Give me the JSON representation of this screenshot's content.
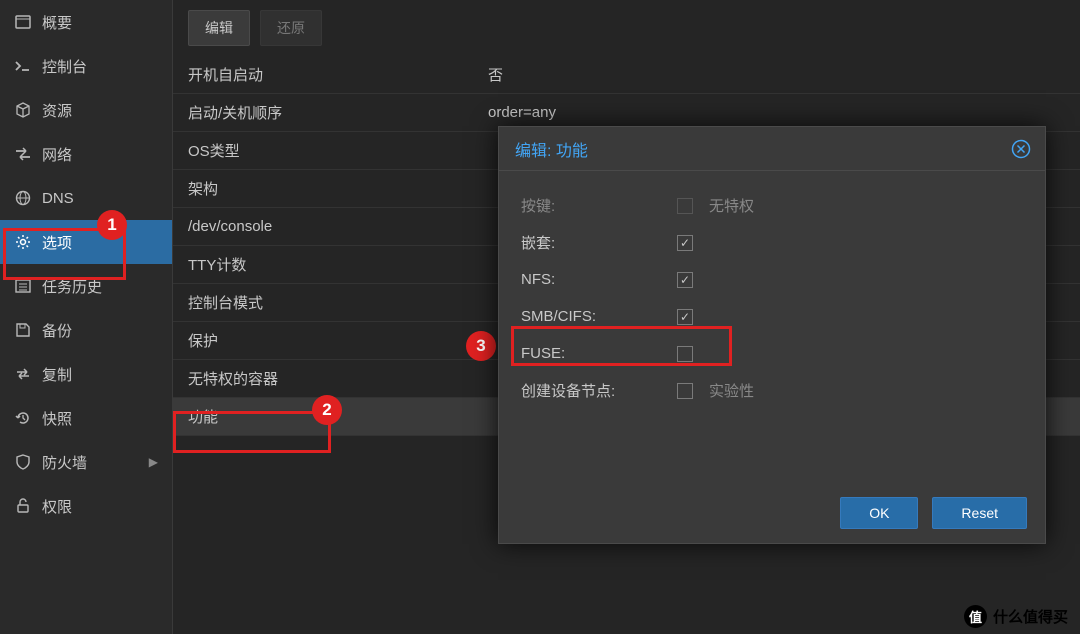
{
  "sidebar": {
    "items": [
      {
        "label": "概要",
        "icon": "summary"
      },
      {
        "label": "控制台",
        "icon": "console"
      },
      {
        "label": "资源",
        "icon": "resources"
      },
      {
        "label": "网络",
        "icon": "network"
      },
      {
        "label": "DNS",
        "icon": "dns"
      },
      {
        "label": "选项",
        "icon": "options",
        "active": true
      },
      {
        "label": "任务历史",
        "icon": "history"
      },
      {
        "label": "备份",
        "icon": "backup"
      },
      {
        "label": "复制",
        "icon": "replicate"
      },
      {
        "label": "快照",
        "icon": "snapshot"
      },
      {
        "label": "防火墙",
        "icon": "firewall",
        "expandable": true
      },
      {
        "label": "权限",
        "icon": "permissions"
      }
    ]
  },
  "toolbar": {
    "edit_label": "编辑",
    "revert_label": "还原"
  },
  "options": [
    {
      "label": "开机自启动",
      "value": "否"
    },
    {
      "label": "启动/关机顺序",
      "value": "order=any"
    },
    {
      "label": "OS类型",
      "value": ""
    },
    {
      "label": "架构",
      "value": ""
    },
    {
      "label": "/dev/console",
      "value": ""
    },
    {
      "label": "TTY计数",
      "value": ""
    },
    {
      "label": "控制台模式",
      "value": ""
    },
    {
      "label": "保护",
      "value": ""
    },
    {
      "label": "无特权的容器",
      "value": ""
    },
    {
      "label": "功能",
      "value": "",
      "selected": true
    }
  ],
  "dialog": {
    "title": "编辑: 功能",
    "rows": [
      {
        "label": "按键:",
        "checked": false,
        "suffix": "无特权",
        "disabled": true
      },
      {
        "label": "嵌套:",
        "checked": true
      },
      {
        "label": "NFS:",
        "checked": true
      },
      {
        "label": "SMB/CIFS:",
        "checked": true
      },
      {
        "label": "FUSE:",
        "checked": false
      },
      {
        "label": "创建设备节点:",
        "checked": false,
        "suffix": "实验性"
      }
    ],
    "ok_label": "OK",
    "reset_label": "Reset"
  },
  "annotations": {
    "badge1": "1",
    "badge2": "2",
    "badge3": "3"
  },
  "watermark": {
    "badge": "值",
    "text": "什么值得买"
  }
}
